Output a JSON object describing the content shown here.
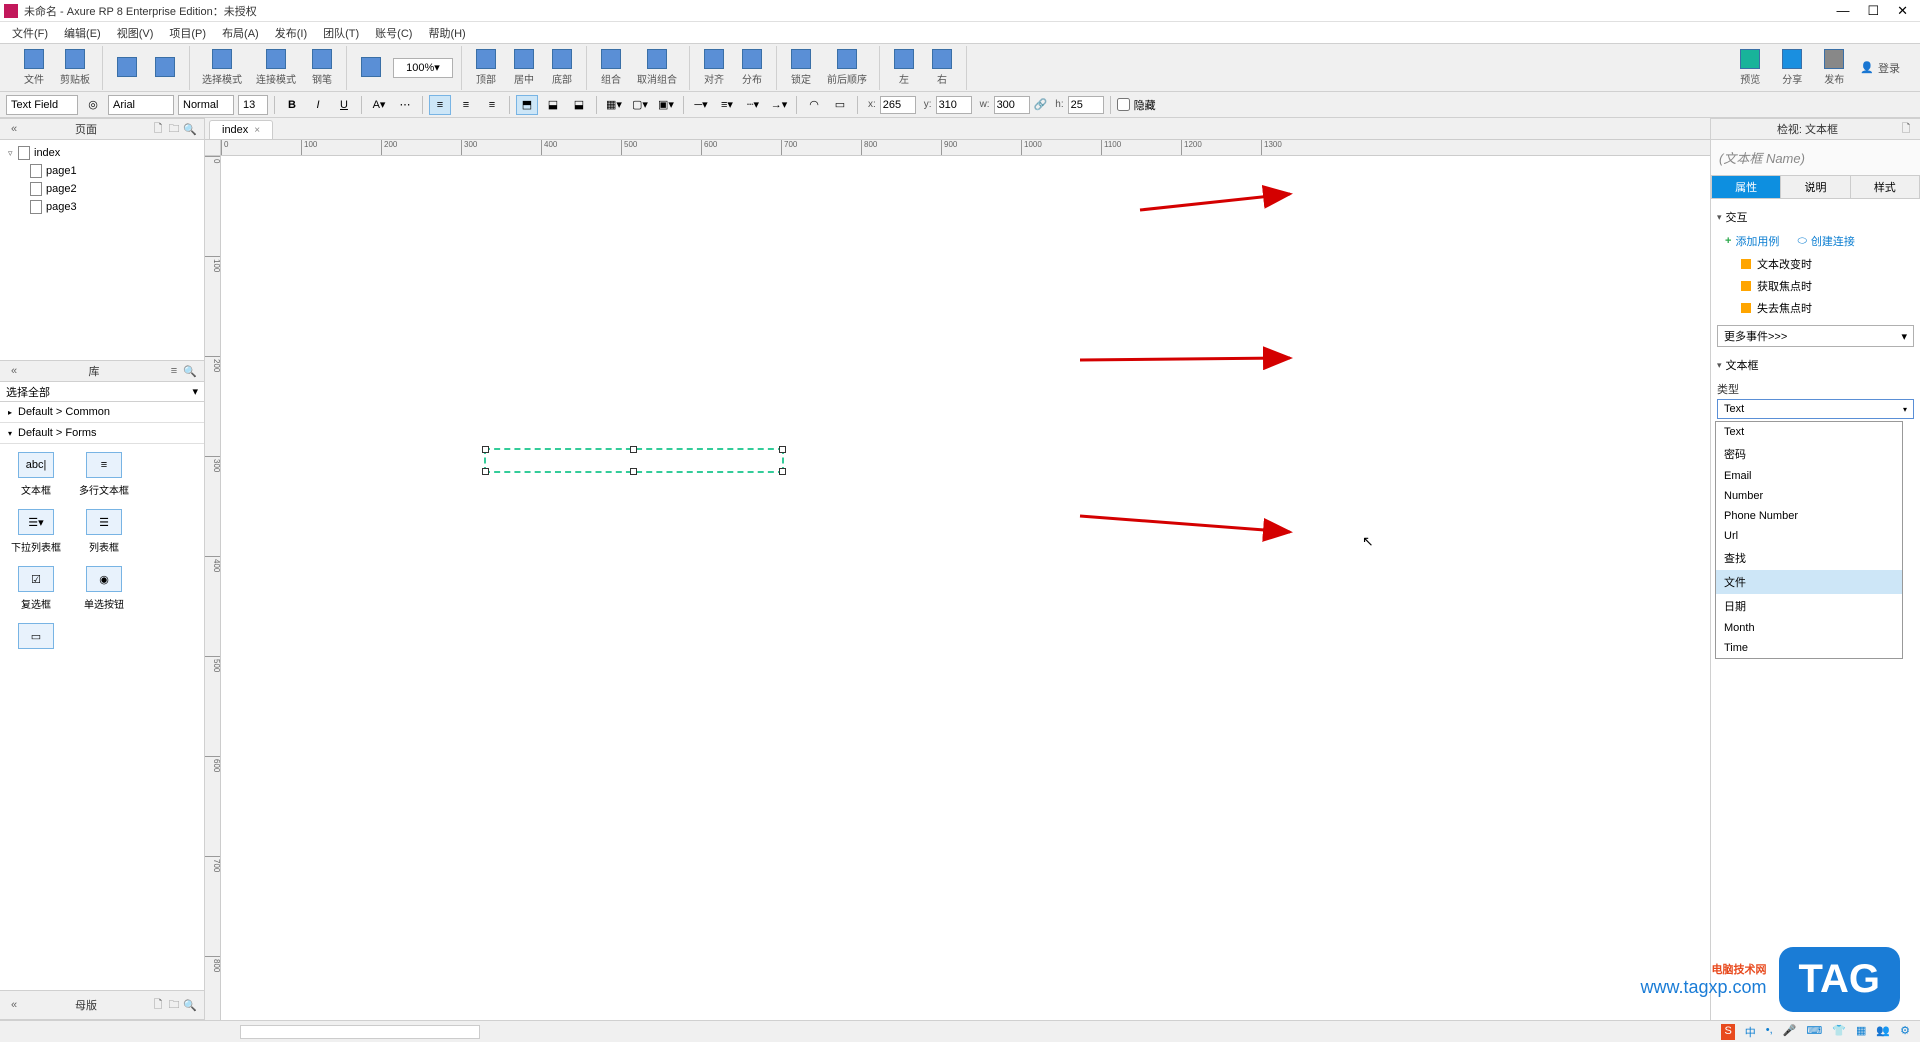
{
  "titlebar": {
    "app_title": "未命名 - Axure RP 8 Enterprise Edition：未授权"
  },
  "menu": {
    "file": "文件(F)",
    "edit": "编辑(E)",
    "view": "视图(V)",
    "project": "项目(P)",
    "layout": "布局(A)",
    "publish": "发布(I)",
    "team": "团队(T)",
    "account": "账号(C)",
    "help": "帮助(H)"
  },
  "toolbar": {
    "cut_paste": "文件",
    "clipboard": "剪贴板",
    "select_mode": "选择模式",
    "connect_mode": "连接模式",
    "pen": "钢笔",
    "zoom_value": "100%",
    "top": "顶部",
    "middle": "居中",
    "bottom": "底部",
    "group": "组合",
    "ungroup": "取消组合",
    "align": "对齐",
    "distribute": "分布",
    "lock": "锁定",
    "front_back": "前后顺序",
    "left": "左",
    "right": "右",
    "preview": "预览",
    "share": "分享",
    "publish": "发布",
    "login": "登录"
  },
  "formatbar": {
    "widget_type": "Text Field",
    "font": "Arial",
    "weight": "Normal",
    "size": "13",
    "x_label": "x:",
    "x_value": "265",
    "y_label": "y:",
    "y_value": "310",
    "w_label": "w:",
    "w_value": "300",
    "h_label": "h:",
    "h_value": "25",
    "hidden": "隐藏"
  },
  "pages_panel": {
    "title": "页面",
    "root": "index",
    "children": [
      "page1",
      "page2",
      "page3"
    ]
  },
  "library_panel": {
    "title": "库",
    "select_all": "选择全部",
    "cat_common": "Default > Common",
    "cat_forms": "Default > Forms",
    "widgets": [
      "文本框",
      "多行文本框",
      "下拉列表框",
      "列表框",
      "复选框",
      "单选按钮"
    ]
  },
  "master_panel": {
    "title": "母版"
  },
  "canvas": {
    "tab": "index",
    "ruler_ticks_h": [
      "0",
      "100",
      "200",
      "300",
      "400",
      "500",
      "600",
      "700",
      "800",
      "900",
      "1000",
      "1100",
      "1200",
      "1300"
    ],
    "ruler_ticks_v": [
      "0",
      "100",
      "200",
      "300",
      "400",
      "500",
      "600",
      "700",
      "800"
    ]
  },
  "inspector": {
    "header": "检视: 文本框",
    "widget_name": "(文本框 Name)",
    "tabs": {
      "properties": "属性",
      "notes": "说明",
      "style": "样式"
    },
    "section_interactions": "交互",
    "add_case": "添加用例",
    "create_link": "创建连接",
    "events": [
      "文本改变时",
      "获取焦点时",
      "失去焦点时"
    ],
    "more_events": "更多事件>>>",
    "section_textfield": "文本框",
    "type_label": "类型",
    "type_value": "Text",
    "type_options": [
      "Text",
      "密码",
      "Email",
      "Number",
      "Phone Number",
      "Url",
      "查找",
      "文件",
      "日期",
      "Month",
      "Time"
    ]
  },
  "watermark": {
    "line1": "电脑技术网",
    "line2": "www.tagxp.com",
    "tag": "TAG"
  }
}
